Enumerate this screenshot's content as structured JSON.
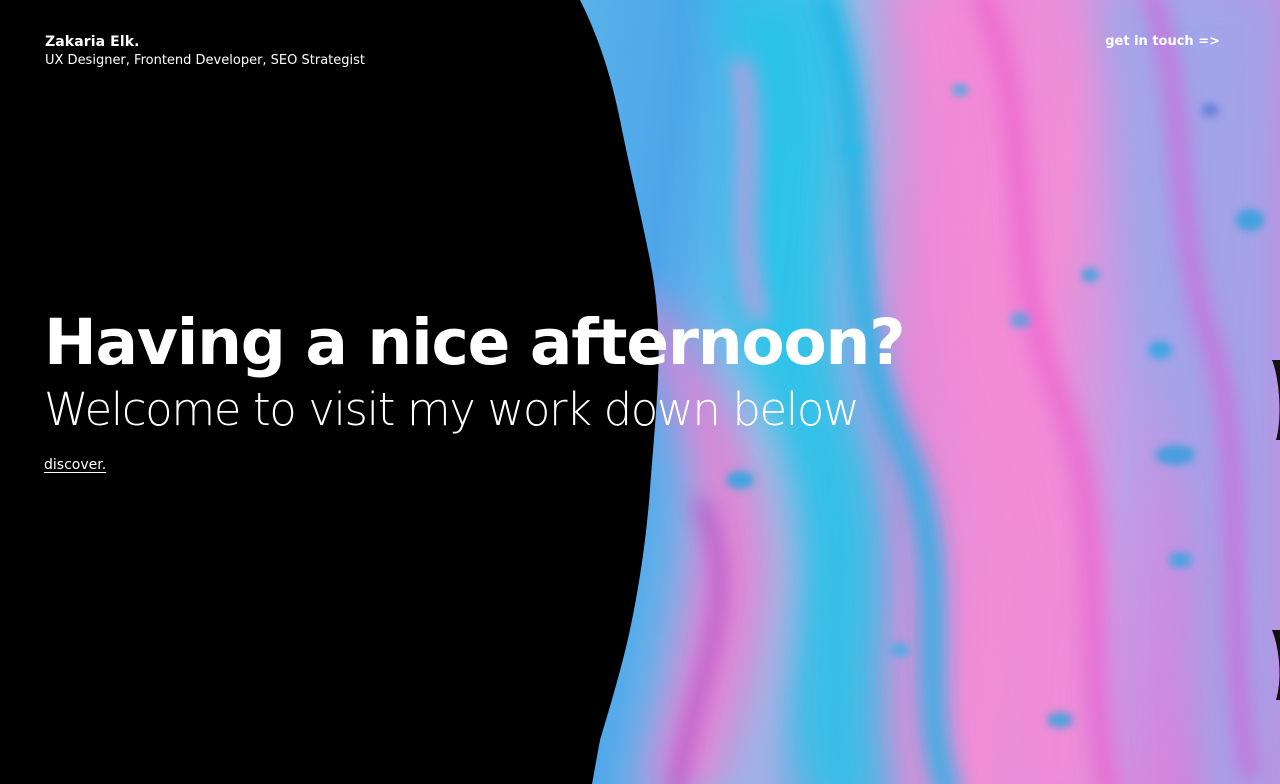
{
  "header": {
    "name": "Zakaria Elk.",
    "tagline": "UX Designer, Frontend Developer, SEO Strategist",
    "contact_label": "get in touch =>"
  },
  "hero": {
    "title": "Having a nice afternoon?",
    "subtitle": "Welcome to visit my work down below",
    "discover_label": "discover."
  },
  "colors": {
    "background": "#000000",
    "text": "#ffffff",
    "art_cyan": "#22c4e6",
    "art_pink": "#ee7fd6",
    "art_blue": "#4fa9ea",
    "art_magenta": "#d23ec9"
  }
}
